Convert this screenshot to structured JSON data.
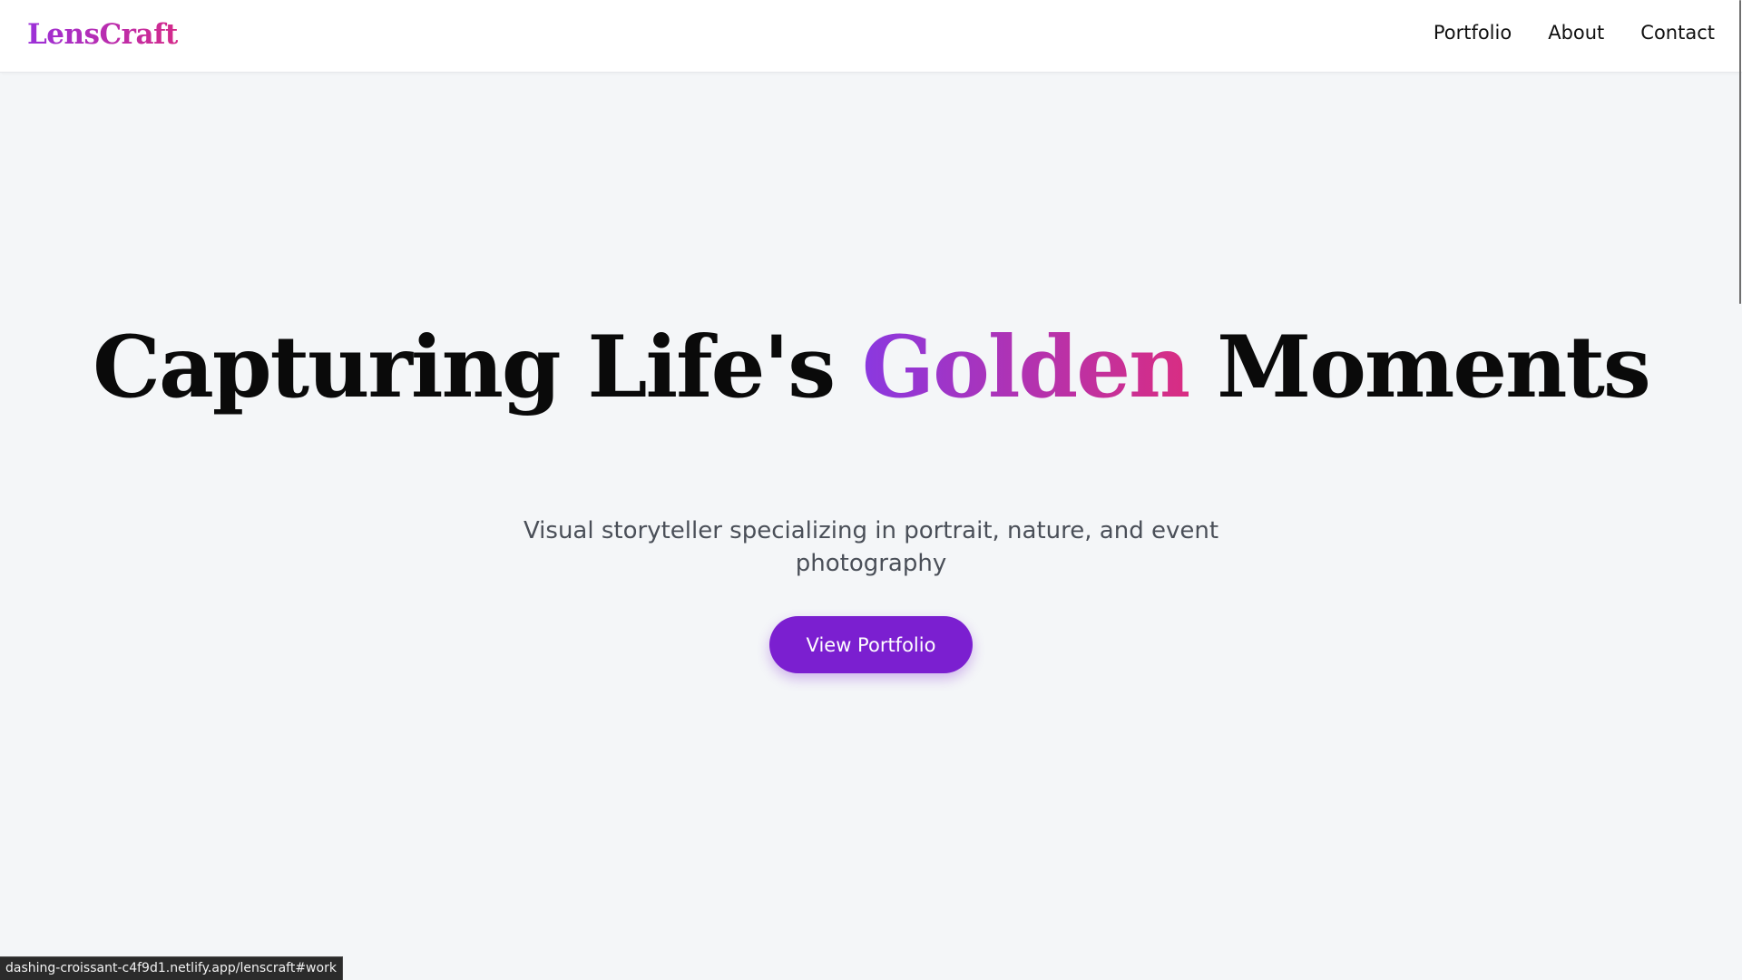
{
  "navbar": {
    "logo": "LensCraft",
    "links": [
      "Portfolio",
      "About",
      "Contact"
    ]
  },
  "hero": {
    "title_before": "Capturing Life's ",
    "title_highlight": "Golden",
    "title_after": " Moments",
    "subtitle": "Visual storyteller specializing in portrait, nature, and event photography",
    "cta_label": "View Portfolio"
  },
  "status_bar": {
    "url": "dashing-croissant-c4f9d1.netlify.app/lenscraft#work"
  },
  "colors": {
    "accent": "#7b1fd0",
    "gradient_start": "#8a38e0",
    "gradient_end": "#d92d82",
    "background": "#f4f6f8"
  }
}
